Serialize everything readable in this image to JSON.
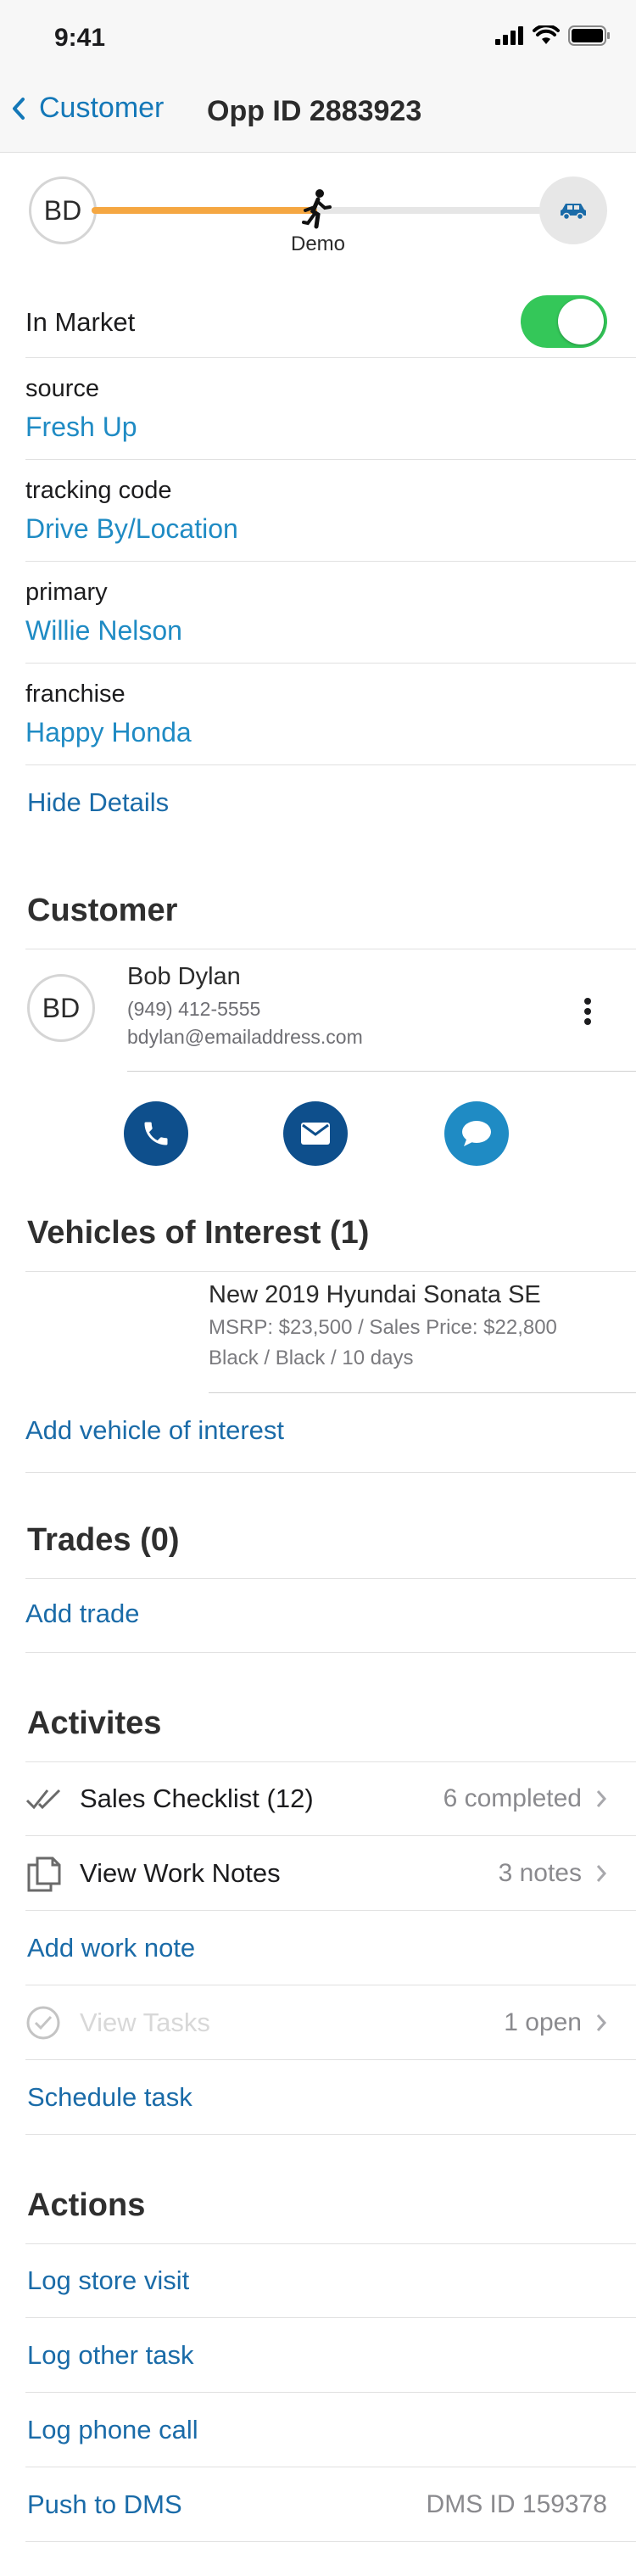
{
  "status": {
    "time": "9:41"
  },
  "nav": {
    "back_label": "Customer",
    "title": "Opp ID 2883923"
  },
  "progress": {
    "initials": "BD",
    "stage": "Demo",
    "fraction": 0.5
  },
  "details": {
    "in_market_label": "In Market",
    "in_market_on": true,
    "fields": [
      {
        "label": "source",
        "value": "Fresh Up"
      },
      {
        "label": "tracking code",
        "value": "Drive By/Location"
      },
      {
        "label": "primary",
        "value": "Willie Nelson"
      },
      {
        "label": "franchise",
        "value": "Happy Honda"
      }
    ],
    "hide_label": "Hide Details"
  },
  "customer": {
    "title": "Customer",
    "initials": "BD",
    "name": "Bob Dylan",
    "phone": "(949) 412-5555",
    "email": "bdylan@emailaddress.com"
  },
  "vehicles": {
    "title": "Vehicles of Interest (1)",
    "item_title": "New 2019 Hyundai Sonata SE",
    "item_price": "MSRP: $23,500 / Sales Price: $22,800",
    "item_detail": "Black / Black / 10 days",
    "add_label": "Add vehicle of interest"
  },
  "trades": {
    "title": "Trades (0)",
    "add_label": "Add trade"
  },
  "activities": {
    "title": "Activites",
    "checklist_label": "Sales Checklist (12)",
    "checklist_right": "6 completed",
    "notes_label": "View Work Notes",
    "notes_right": "3 notes",
    "add_note_label": "Add work note",
    "tasks_label": "View Tasks",
    "tasks_right": "1 open",
    "schedule_label": "Schedule task"
  },
  "actions": {
    "title": "Actions",
    "store_visit": "Log store visit",
    "other_task": "Log other task",
    "phone_call": "Log phone call",
    "push_dms": "Push to DMS",
    "dms_id": "DMS ID 159378"
  },
  "colors": {
    "accent": "#1a6ba8",
    "value": "#1f8bc4",
    "progress": "#f5a742",
    "toggle": "#34c759",
    "dark_button": "#0e4f8c",
    "light_button": "#1f8bc4"
  }
}
